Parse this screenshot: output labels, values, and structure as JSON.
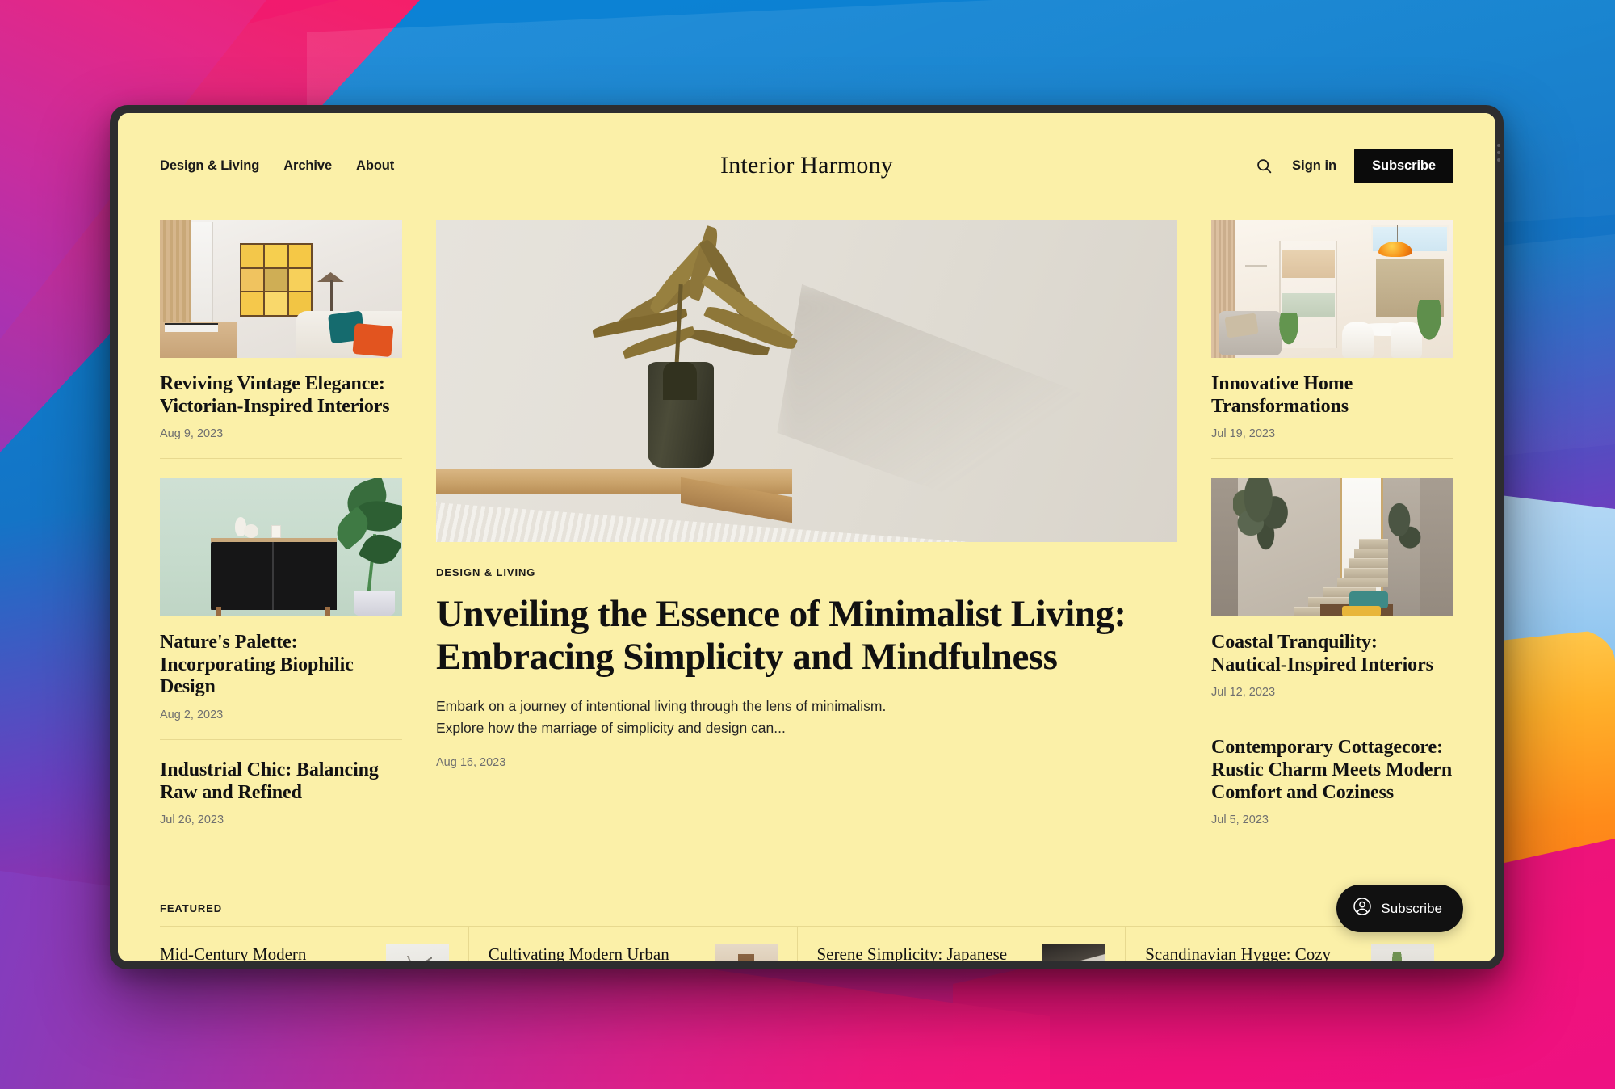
{
  "site": {
    "brand": "Interior Harmony",
    "nav": [
      {
        "label": "Design & Living"
      },
      {
        "label": "Archive"
      },
      {
        "label": "About"
      }
    ],
    "search_icon": "search-icon",
    "signin_label": "Sign in",
    "subscribe_label": "Subscribe"
  },
  "left_column": [
    {
      "title": "Reviving Vintage Elegance: Victorian-Inspired Interiors",
      "date": "Aug 9, 2023",
      "image": "living-room-yellow-grid-art"
    },
    {
      "title": "Nature's Palette: Incorporating Biophilic Design",
      "date": "Aug 2, 2023",
      "image": "black-marble-sideboard-sage-wall"
    },
    {
      "title": "Industrial Chic: Balancing Raw and Refined",
      "date": "Jul 26, 2023",
      "image": null
    }
  ],
  "hero": {
    "kicker": "DESIGN & LIVING",
    "title": "Unveiling the Essence of Minimalist Living: Embracing Simplicity and Mindfulness",
    "excerpt": "Embark on a journey of intentional living through the lens of minimalism. Explore how the marriage of simplicity and design can...",
    "date": "Aug 16, 2023",
    "image": "dark-vase-dried-palm-on-wood-shelf"
  },
  "right_column": [
    {
      "title": "Innovative Home Transformations",
      "date": "Jul 19, 2023",
      "image": "open-plan-living-orange-pendant"
    },
    {
      "title": "Coastal Tranquility: Nautical-Inspired Interiors",
      "date": "Jul 12, 2023",
      "image": "stone-staircase-olive-tree"
    },
    {
      "title": "Contemporary Cottagecore: Rustic Charm Meets Modern Comfort and Coziness",
      "date": "Jul 5, 2023",
      "image": null
    }
  ],
  "featured": {
    "label": "FEATURED",
    "items": [
      {
        "title": "Mid-Century Modern Elegance: Timeless Icons",
        "image": "abstract-wire-sculpture"
      },
      {
        "title": "Cultivating Modern Urban Green Spaces",
        "image": "urban-living-room-plants"
      },
      {
        "title": "Serene Simplicity: Japanese Zen Interiors",
        "image": "zen-dark-interior-detail"
      },
      {
        "title": "Scandinavian Hygge: Cozy Comfort for Every Season",
        "image": "scandi-vase-and-basket"
      }
    ]
  },
  "floating": {
    "subscribe_label": "Subscribe",
    "avatar_icon": "user-circle-icon"
  },
  "colors": {
    "page_background": "#fbf0a8",
    "accent_dark": "#0b0b0b",
    "text": "#121212",
    "muted_text": "#6f6f6f",
    "divider": "#e7d98f"
  }
}
